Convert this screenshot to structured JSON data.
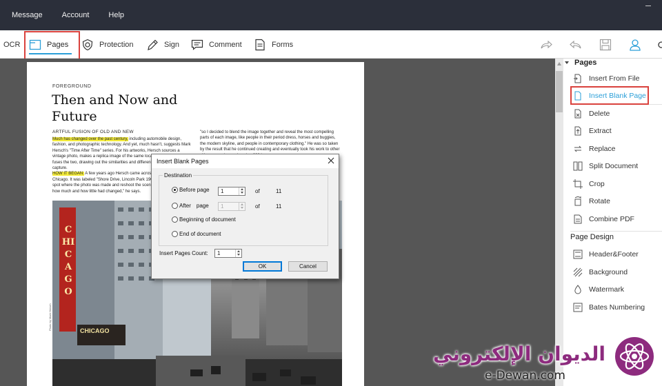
{
  "menubar": {
    "items": [
      "Message",
      "Account",
      "Help"
    ]
  },
  "toolbar": {
    "ocr": "OCR",
    "pages": "Pages",
    "protection": "Protection",
    "sign": "Sign",
    "comment": "Comment",
    "forms": "Forms",
    "right_icons": [
      "redo-icon",
      "undo-icon",
      "save-icon",
      "user-icon"
    ]
  },
  "document": {
    "foreground": "FOREGROUND",
    "title": "Then and Now and Future",
    "subtitle": "ARTFUL FUSION OF OLD AND NEW",
    "left_col": {
      "hl1": "Much has changed over the past century,",
      "p1": " including automobile design, fashion, and photographic technology. And yet, much hasn't, suggests Mark Hersch's \"Time After Time\" series. For his artworks, Hersch sources a vintage photo, makes a replica image of the same location today, and then fuses the two, drawing out the similarities and differences between each capture.",
      "hl2": "HOW IT BEGAN:",
      "p2": " A few years ago Hersch came across an old photo of Chicago. It was labeled \"Shore Drive, Lincoln Park 1905\". He went to the spot where the photo was made and reshoot the scene. \"I was fascinated by how much and how little had changed,\" he says."
    },
    "right_col": "\"so I decided to blend the image together and reveal the most compelling parts of each image, like people in their period dress, horses and buggies, the modern skyline, and people in contemporary clothing.\" He was so taken by the result that he continued creating and eventually took his work to other cities, amassing a whopping 200 images.",
    "photo_sign": "CHICAGO",
    "photo_marquee": "CHICAGO",
    "photo_credit": "Photo by Mark Hersch"
  },
  "dialog": {
    "title": "Insert Blank Pages",
    "group_label": "Destination",
    "before_label": "Before page",
    "before_value": "1",
    "before_of": "of",
    "before_total": "11",
    "after_label": "After",
    "after_page_label": "page",
    "after_value": "1",
    "after_of": "of",
    "after_total": "11",
    "beginning_label": "Beginning of document",
    "end_label": "End of document",
    "count_label": "Insert Pages Count:",
    "count_value": "1",
    "ok": "OK",
    "cancel": "Cancel",
    "selected": "before"
  },
  "panel": {
    "pages_header": "Pages",
    "pages_items": [
      "Insert From File",
      "Insert Blank Page",
      "Delete",
      "Extract",
      "Replace",
      "Split Document",
      "Crop",
      "Rotate",
      "Combine PDF"
    ],
    "active_item": "Insert Blank Page",
    "design_header": "Page Design",
    "design_items": [
      "Header&Footer",
      "Background",
      "Watermark",
      "Bates Numbering"
    ]
  },
  "watermark": {
    "arabic": "الديوان الإلكتروني",
    "english": "e-Dewan.com"
  },
  "colors": {
    "accent": "#2b9fd8",
    "highlight_box": "#d9413c",
    "menubar": "#2b2f3a",
    "watermark": "#8d2b7e"
  }
}
